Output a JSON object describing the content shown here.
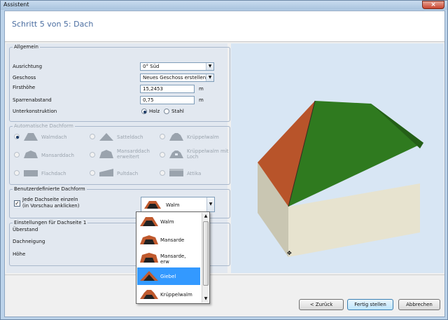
{
  "window": {
    "title": "Assistent",
    "close_icon": "×"
  },
  "header": {
    "step": "Schritt 5 von 5:  Dach"
  },
  "allgemein": {
    "caption": "Allgemein",
    "ausrichtung_label": "Ausrichtung",
    "ausrichtung_value": "0° Süd",
    "geschoss_label": "Geschoss",
    "geschoss_value": "Neues Geschoss erstellen",
    "firsthoehe_label": "Firsthöhe",
    "firsthoehe_value": "15,2453",
    "firsthoehe_unit": "m",
    "sparren_label": "Sparrenabstand",
    "sparren_value": "0,75",
    "sparren_unit": "m",
    "unterkonstruktion_label": "Unterkonstruktion",
    "holz": "Holz",
    "stahl": "Stahl"
  },
  "auto": {
    "caption": "Automatische Dachform",
    "items": [
      "Walmdach",
      "Satteldach",
      "Krüppelwalm",
      "Mansarddach",
      "Mansarddach erweitert",
      "Krüppelwalm mit Loch",
      "Flachdach",
      "Pultdach",
      "Attika"
    ]
  },
  "benutzer": {
    "caption": "Benutzerdefinierte Dachform",
    "check_line1": "Jede Dachseite einzeln",
    "check_line2": "(in Vorschau anklicken)",
    "combo_value": "Walm"
  },
  "dachseite": {
    "caption": "Einstellungen für Dachseite 1",
    "ueberstand": "Überstand",
    "dachneigung": "Dachneigung",
    "hoehe": "Höhe"
  },
  "dropdown": {
    "options": [
      "Walm",
      "Mansarde",
      "Mansarde, erw",
      "Giebel",
      "Krüppelwalm"
    ],
    "selected": "Giebel"
  },
  "buttons": {
    "back": "< Zurück",
    "finish": "Fertig stellen",
    "cancel": "Abbrechen"
  },
  "colors": {
    "roof_green": "#2f7a1f",
    "roof_tile": "#b8542a",
    "wall": "#e7e3cf",
    "selection": "#3399ff"
  }
}
